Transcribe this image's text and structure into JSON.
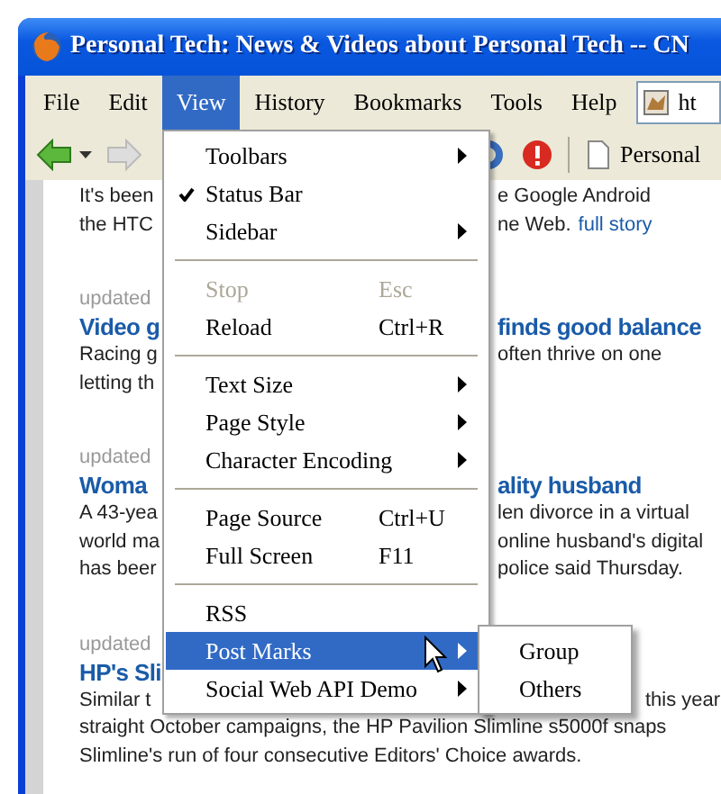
{
  "window": {
    "title": "Personal Tech: News & Videos about Personal Tech -- CN"
  },
  "menu_bar": [
    {
      "label": "File",
      "selected": false
    },
    {
      "label": "Edit",
      "selected": false
    },
    {
      "label": "View",
      "selected": true
    },
    {
      "label": "History",
      "selected": false
    },
    {
      "label": "Bookmarks",
      "selected": false
    },
    {
      "label": "Tools",
      "selected": false
    },
    {
      "label": "Help",
      "selected": false
    }
  ],
  "address_field": {
    "value": "ht"
  },
  "toolbar": {
    "bookmark": "Personal"
  },
  "content": {
    "lines": [
      {
        "kind": "text",
        "left": "It's been",
        "right": "e Google Android"
      },
      {
        "kind": "text",
        "left": "the HTC",
        "right": "ne Web.",
        "link": "full story"
      },
      {
        "kind": "updated",
        "left": "updated"
      },
      {
        "kind": "headline",
        "left": "Video g",
        "right": "finds good balance"
      },
      {
        "kind": "text",
        "left": "Racing g",
        "right": "often thrive on one"
      },
      {
        "kind": "text",
        "left": "letting th"
      },
      {
        "kind": "updated",
        "left": "updated"
      },
      {
        "kind": "headline",
        "left": "Woma",
        "right": "ality husband"
      },
      {
        "kind": "text",
        "left": "A 43-yea",
        "right": "len divorce in a virtual"
      },
      {
        "kind": "text",
        "left": "world ma",
        "right": "online husband's digital"
      },
      {
        "kind": "text",
        "left": "has beer",
        "right": "police said Thursday."
      },
      {
        "kind": "updated",
        "left": "updated"
      },
      {
        "kind": "headline",
        "left": "HP's Sli"
      },
      {
        "kind": "text",
        "left": "Similar t",
        "right": "this year"
      },
      {
        "kind": "text",
        "left": "straight October campaigns, the HP Pavilion Slimline s5000f snaps"
      },
      {
        "kind": "text",
        "left": "Slimline's run of four consecutive Editors' Choice awards."
      }
    ]
  },
  "view_menu": {
    "items": [
      {
        "kind": "item",
        "label": "Toolbars",
        "has_submenu": true,
        "checked": false,
        "disabled": false,
        "selected": false
      },
      {
        "kind": "item",
        "label": "Status Bar",
        "has_submenu": false,
        "checked": true,
        "disabled": false,
        "selected": false
      },
      {
        "kind": "item",
        "label": "Sidebar",
        "has_submenu": true,
        "checked": false,
        "disabled": false,
        "selected": false
      },
      {
        "kind": "separator"
      },
      {
        "kind": "item",
        "label": "Stop",
        "shortcut": "Esc",
        "has_submenu": false,
        "checked": false,
        "disabled": true,
        "selected": false
      },
      {
        "kind": "item",
        "label": "Reload",
        "shortcut": "Ctrl+R",
        "has_submenu": false,
        "checked": false,
        "disabled": false,
        "selected": false
      },
      {
        "kind": "separator"
      },
      {
        "kind": "item",
        "label": "Text Size",
        "has_submenu": true,
        "checked": false,
        "disabled": false,
        "selected": false
      },
      {
        "kind": "item",
        "label": "Page Style",
        "has_submenu": true,
        "checked": false,
        "disabled": false,
        "selected": false
      },
      {
        "kind": "item",
        "label": "Character Encoding",
        "has_submenu": true,
        "checked": false,
        "disabled": false,
        "selected": false
      },
      {
        "kind": "separator"
      },
      {
        "kind": "item",
        "label": "Page Source",
        "shortcut": "Ctrl+U",
        "has_submenu": false,
        "checked": false,
        "disabled": false,
        "selected": false
      },
      {
        "kind": "item",
        "label": "Full Screen",
        "shortcut": "F11",
        "has_submenu": false,
        "checked": false,
        "disabled": false,
        "selected": false
      },
      {
        "kind": "separator"
      },
      {
        "kind": "item",
        "label": "RSS",
        "has_submenu": false,
        "checked": false,
        "disabled": false,
        "selected": false
      },
      {
        "kind": "item",
        "label": "Post Marks",
        "has_submenu": true,
        "checked": false,
        "disabled": false,
        "selected": true
      },
      {
        "kind": "item",
        "label": "Social Web API Demo",
        "has_submenu": true,
        "checked": false,
        "disabled": false,
        "selected": false
      }
    ]
  },
  "submenu": {
    "items": [
      {
        "label": "Group",
        "selected": false
      },
      {
        "label": "Others",
        "selected": false
      }
    ]
  }
}
